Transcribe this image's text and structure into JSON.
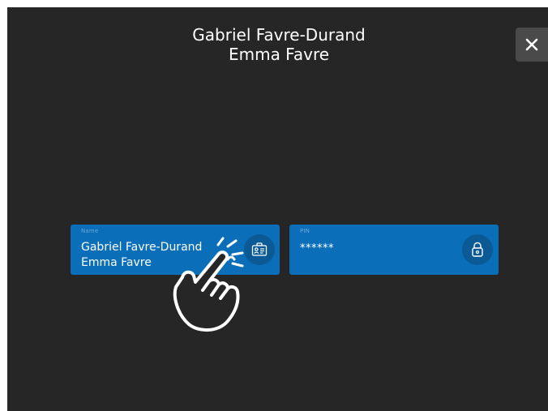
{
  "header": {
    "names": [
      "Gabriel Favre-Durand",
      "Emma Favre"
    ]
  },
  "close_button": {
    "icon": "close-icon",
    "glyph": "✕"
  },
  "fields": {
    "name": {
      "label": "Name",
      "lines": [
        "Gabriel Favre-Durand",
        "Emma Favre"
      ],
      "icon": "id-card-icon"
    },
    "pin": {
      "label": "PIN",
      "value": "******",
      "icon": "lock-icon"
    }
  },
  "overlay": {
    "icon": "tap-hand-icon"
  },
  "colors": {
    "background": "#262626",
    "field": "#0a6eb8",
    "icon_circle": "#0b5a96",
    "close_bg": "#4a4a4a",
    "text": "#ffffff"
  }
}
